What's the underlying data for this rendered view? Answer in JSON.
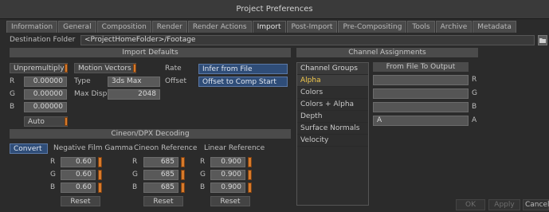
{
  "window": {
    "title": "Project Preferences"
  },
  "tabs": [
    "Information",
    "General",
    "Composition",
    "Render",
    "Render Actions",
    "Import",
    "Post-Import",
    "Pre-Compositing",
    "Tools",
    "Archive",
    "Metadata"
  ],
  "active_tab": "Import",
  "destination": {
    "label": "Destination Folder",
    "value": "<ProjectHomeFolder>/Footage"
  },
  "import_defaults": {
    "title": "Import Defaults",
    "unpremultiply_label": "Unpremultiply",
    "motion_vectors_label": "Motion Vectors",
    "channel_labels": [
      "R",
      "G",
      "B"
    ],
    "channel_values": [
      "0.00000",
      "0.00000",
      "0.00000"
    ],
    "type_label": "Type",
    "type_value": "3ds Max",
    "max_disp_label": "Max Disp",
    "max_disp_value": "2048",
    "rate_label": "Rate",
    "rate_value": "Infer from File",
    "offset_label": "Offset",
    "offset_value": "Offset to Comp Start",
    "auto_label": "Auto"
  },
  "cineon": {
    "title": "Cineon/DPX Decoding",
    "convert_label": "Convert",
    "neg_gamma_label": "Negative Film Gamma",
    "cineon_ref_label": "Cineon Reference",
    "linear_ref_label": "Linear Reference",
    "channel_labels": [
      "R",
      "G",
      "B"
    ],
    "neg_gamma_values": [
      "0.60",
      "0.60",
      "0.60"
    ],
    "cineon_ref_values": [
      "685",
      "685",
      "685"
    ],
    "linear_ref_values": [
      "0.900",
      "0.900",
      "0.900"
    ],
    "reset_label": "Reset"
  },
  "channel_assignments": {
    "title": "Channel Assignments",
    "groups_header": "Channel Groups",
    "groups": [
      "Alpha",
      "Colors",
      "Colors + Alpha",
      "Depth",
      "Surface Normals",
      "Velocity"
    ],
    "selected_group": "Alpha",
    "output_header": "From File To Output",
    "outputs": [
      {
        "value": "",
        "label": "R"
      },
      {
        "value": "",
        "label": "G"
      },
      {
        "value": "",
        "label": "B"
      },
      {
        "value": "A",
        "label": "A"
      }
    ]
  },
  "buttons": {
    "ok": "OK",
    "apply": "Apply",
    "cancel": "Cancel"
  },
  "colors": {
    "accent_orange": "#d77a2a",
    "selection_yellow": "#f2c94c",
    "active_blue": "#2f4d78"
  }
}
